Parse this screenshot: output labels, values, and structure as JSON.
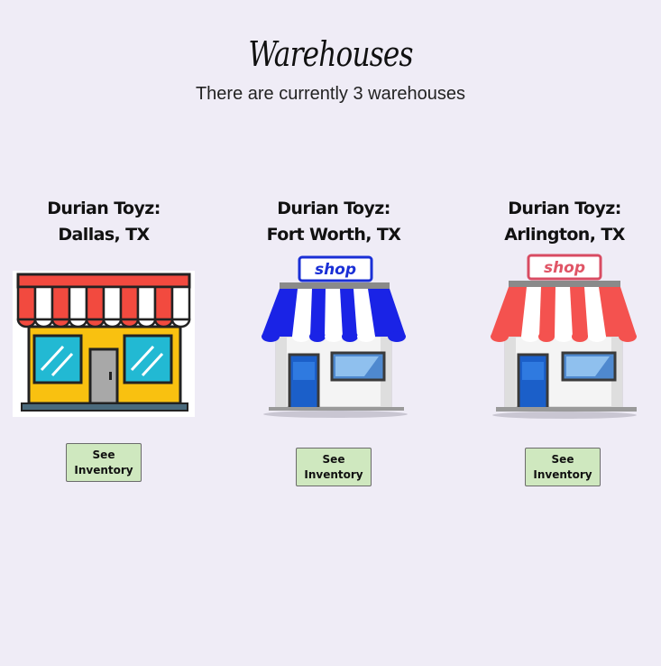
{
  "header": {
    "title": "Warehouses",
    "subtitle": "There are currently 3 warehouses"
  },
  "warehouses": [
    {
      "name_line1": "Durian Toyz:",
      "name_line2": "Dallas, TX",
      "button_label": "See Inventory",
      "image_icon": "storefront-icon"
    },
    {
      "name_line1": "Durian Toyz:",
      "name_line2": "Fort Worth, TX",
      "button_label": "See Inventory",
      "image_icon": "blue-shop-icon",
      "sign_text": "shop"
    },
    {
      "name_line1": "Durian Toyz:",
      "name_line2": "Arlington, TX",
      "button_label": "See Inventory",
      "image_icon": "red-shop-icon",
      "sign_text": "shop"
    }
  ],
  "colors": {
    "background": "#efecf6",
    "button_bg": "#cfe8bf",
    "awning_red": "#f4524f",
    "awning_blue": "#1a23e6",
    "store_yellow": "#f9c110",
    "window_cyan": "#22b9d3",
    "door_blue": "#1b5fc9"
  }
}
